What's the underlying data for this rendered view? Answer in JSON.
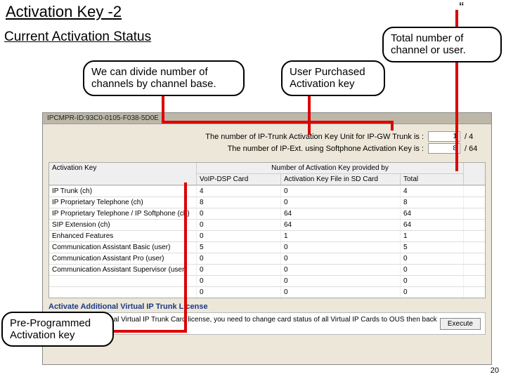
{
  "page": {
    "title": "Activation Key -2",
    "quote_mark": "“",
    "subtitle": "Current Activation Status",
    "page_number": "20"
  },
  "callouts": {
    "total": "Total number of channel or user.",
    "divide": "We can divide number of channels by channel base.",
    "user_key": "User Purchased Activation key",
    "pre_programmed": "Pre-Programmed Activation key"
  },
  "app": {
    "titlebar": "IPCMPR-ID:93C0-0105-F038-5D0E",
    "summary": {
      "row1_label": "The number of IP-Trunk Activation Key Unit for IP-GW Trunk is :",
      "row1_value": "1",
      "row1_max": "/ 4",
      "row2_label": "The number of IP-Ext. using Softphone Activation Key is :",
      "row2_value": "8",
      "row2_max": "/ 64"
    },
    "table": {
      "header_group": "Number of Activation Key provided by",
      "col_key": "Activation Key",
      "col_card": "VoIP-DSP Card",
      "col_sd": "Activation Key File in SD Card",
      "col_total": "Total",
      "rows": [
        {
          "key": "IP Trunk (ch)",
          "card": "4",
          "sd": "0",
          "total": "4"
        },
        {
          "key": "IP Proprietary Telephone (ch)",
          "card": "8",
          "sd": "0",
          "total": "8"
        },
        {
          "key": "IP Proprietary Telephone / IP Softphone (ch)",
          "card": "0",
          "sd": "64",
          "total": "64"
        },
        {
          "key": "SIP Extension (ch)",
          "card": "0",
          "sd": "64",
          "total": "64"
        },
        {
          "key": "Enhanced Features",
          "card": "0",
          "sd": "1",
          "total": "1"
        },
        {
          "key": "Communication Assistant Basic (user)",
          "card": "5",
          "sd": "0",
          "total": "5"
        },
        {
          "key": "Communication Assistant Pro (user)",
          "card": "0",
          "sd": "0",
          "total": "0"
        },
        {
          "key": "Communication Assistant Supervisor (user)",
          "card": "0",
          "sd": "0",
          "total": "0"
        },
        {
          "key": "",
          "card": "0",
          "sd": "0",
          "total": "0"
        },
        {
          "key": "",
          "card": "0",
          "sd": "0",
          "total": "0"
        }
      ]
    },
    "license": {
      "title": "Activate Additional Virtual IP Trunk License",
      "text": "To activate additional Virtual IP Trunk Card license, you need to change card status of all Virtual IP Cards to OUS then back to INS.",
      "button": "Execute"
    }
  }
}
